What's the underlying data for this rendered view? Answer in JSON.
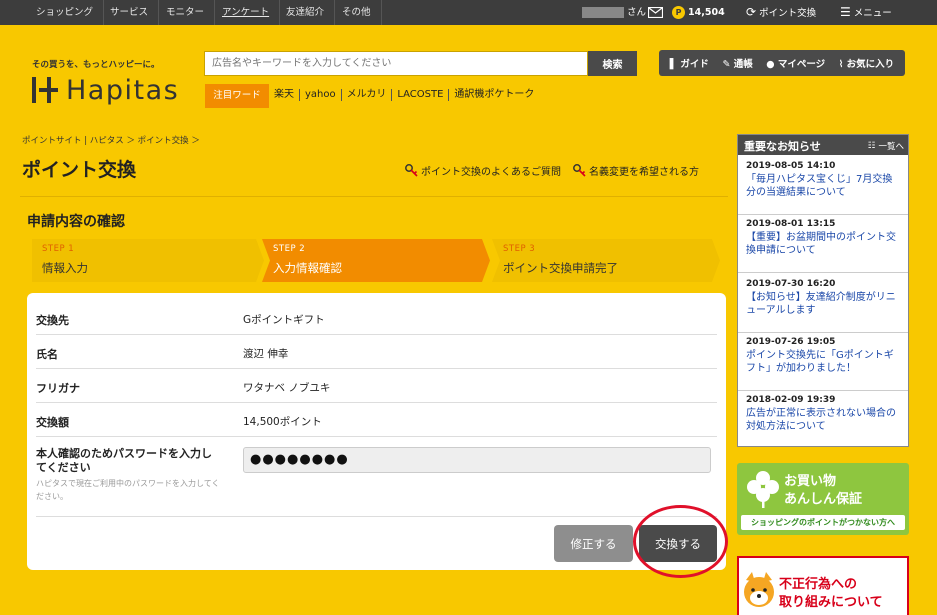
{
  "topnav": {
    "items": [
      "ショッピング",
      "サービス",
      "モニター",
      "アンケート",
      "友達紹介",
      "その他"
    ],
    "user_suffix": "さん",
    "points": "14,504",
    "point_exchange": "ポイント交換",
    "menu": "メニュー"
  },
  "header": {
    "tagline": "その買うを、もっとハッピーに。",
    "logo_text": "Hapitas",
    "search_placeholder": "広告名やキーワードを入力してください",
    "search_button": "検索",
    "hot_label": "注目ワード",
    "hot_words": [
      "楽天",
      "yahoo",
      "メルカリ",
      "LACOSTE",
      "通訳機ポケトーク"
    ],
    "user_links": [
      "ガイド",
      "通帳",
      "マイページ",
      "お気に入り"
    ]
  },
  "breadcrumb": "ポイントサイト | ハピタス ＞ ポイント交換 ＞",
  "page_title": "ポイント交換",
  "help_links": [
    "ポイント交換のよくあるご質問",
    "名義変更を希望される方"
  ],
  "section_title": "申請内容の確認",
  "steps": [
    {
      "label": "STEP 1",
      "name": "情報入力"
    },
    {
      "label": "STEP 2",
      "name": "入力情報確認"
    },
    {
      "label": "STEP 3",
      "name": "ポイント交換申請完了"
    }
  ],
  "form": {
    "rows": [
      {
        "label": "交換先",
        "value": "Gポイントギフト"
      },
      {
        "label": "氏名",
        "value": "渡辺 伸幸"
      },
      {
        "label": "フリガナ",
        "value": "ワタナベ ノブユキ"
      },
      {
        "label": "交換額",
        "value": "14,500ポイント"
      }
    ],
    "password_label": "本人確認のためパスワードを入力してください",
    "password_hint": "ハピタスで現在ご利用中のパスワードを入力してください。",
    "password_value": "●●●●●●●●",
    "fix_button": "修正する",
    "exchange_button": "交換する"
  },
  "news": {
    "title": "重要なお知らせ",
    "all_link": "一覧へ",
    "items": [
      {
        "date": "2019-08-05 14:10",
        "text": "「毎月ハピタス宝くじ」7月交換分の当選結果について"
      },
      {
        "date": "2019-08-01 13:15",
        "text": "【重要】お盆期間中のポイント交換申請について"
      },
      {
        "date": "2019-07-30 16:20",
        "text": "【お知らせ】友達紹介制度がリニューアルします"
      },
      {
        "date": "2019-07-26 19:05",
        "text": "ポイント交換先に「Gポイントギフト」が加わりました！"
      },
      {
        "date": "2018-02-09 19:39",
        "text": "広告が正常に表示されない場合の対処方法について"
      }
    ]
  },
  "banners": {
    "safe_line1": "お買い物",
    "safe_line2": "あんしん保証",
    "safe_strip": "ショッピングのポイントがつかない方へ",
    "fraud_line1": "不正行為への",
    "fraud_line2": "取り組みについて"
  }
}
